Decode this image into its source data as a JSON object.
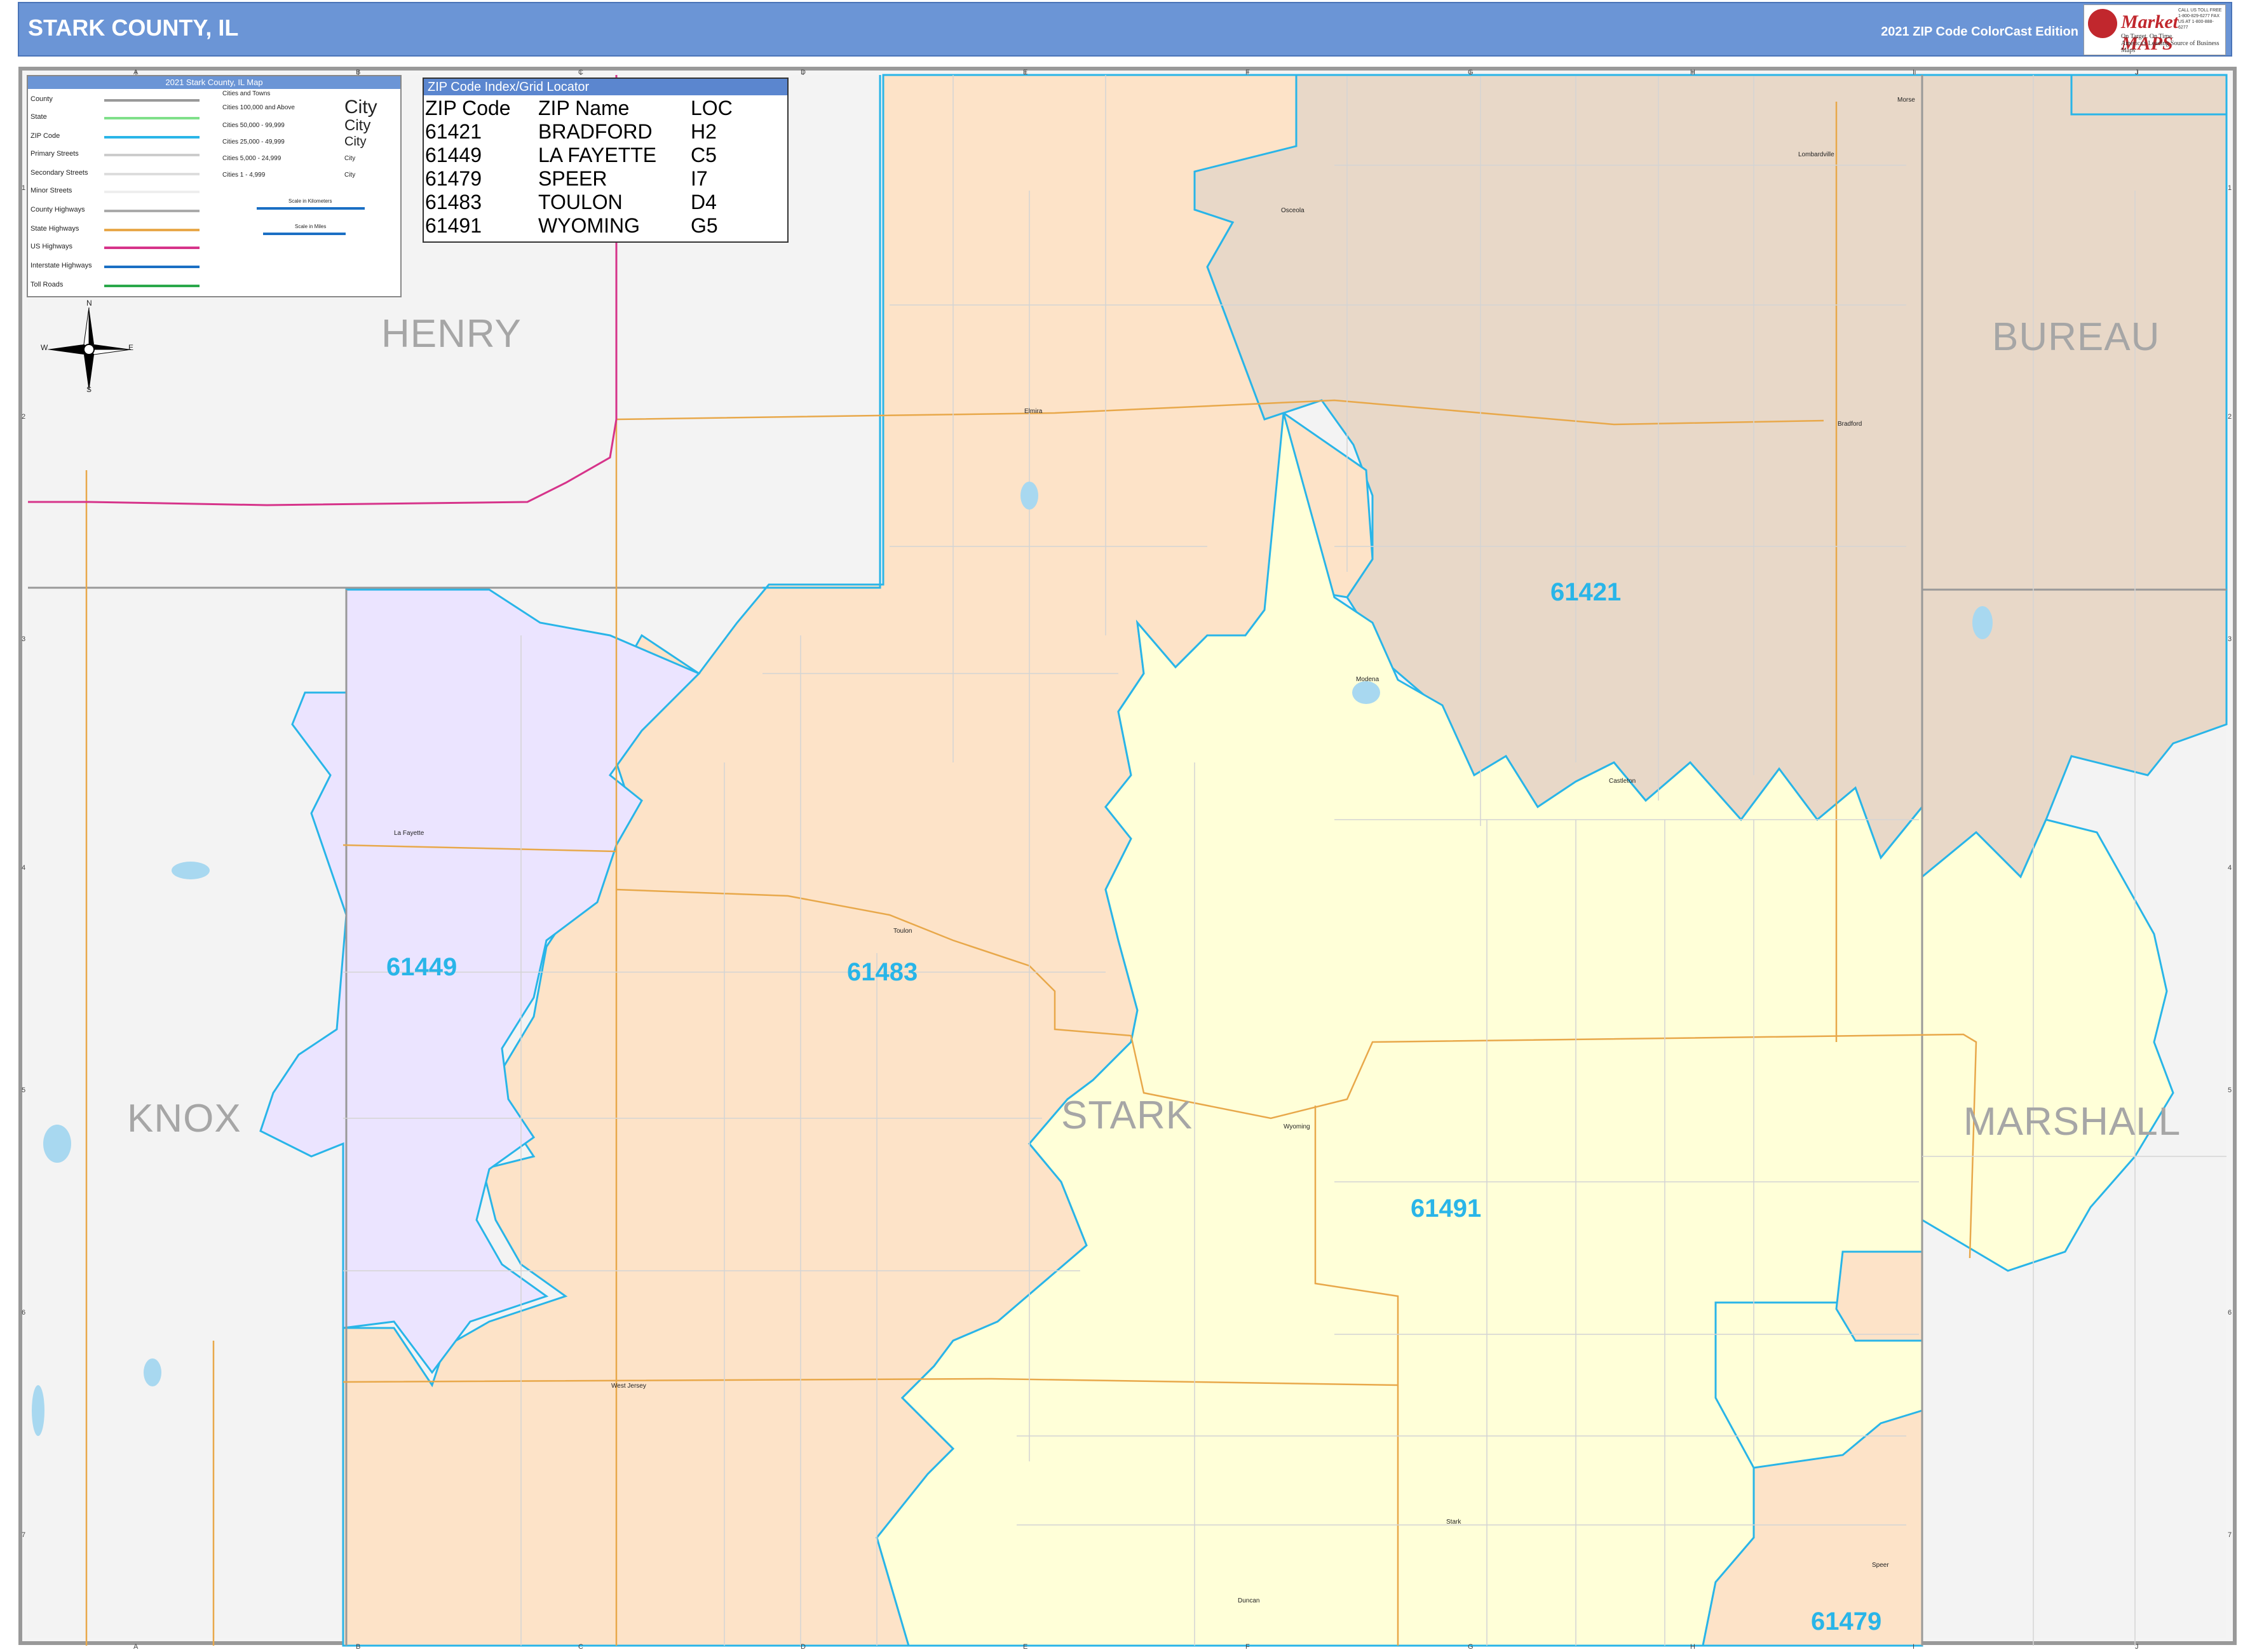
{
  "header": {
    "title": "STARK COUNTY, IL",
    "edition": "2021 ZIP Code ColorCast Edition",
    "logo": {
      "brand": "Market MAPS",
      "tagline": "On Target. On Time.",
      "slogan": "America's Leading Source of Business Maps",
      "contact": "CALL US TOLL FREE 1-800-829-6277 FAX US AT 1-800-888-6277"
    }
  },
  "legend": {
    "title": "2021 Stark County, IL Map",
    "items": [
      "County",
      "State",
      "ZIP Code",
      "Primary Streets",
      "Secondary Streets",
      "Minor Streets",
      "County Highways",
      "State Highways",
      "US Highways",
      "Interstate Highways",
      "Toll Roads"
    ],
    "cities_header": "Cities and Towns",
    "city_sizes": [
      "Cities 100,000 and Above",
      "Cities 50,000 - 99,999",
      "Cities 25,000 - 49,999",
      "Cities 5,000 - 24,999",
      "Cities 1 - 4,999"
    ],
    "city_samples": [
      "City",
      "City",
      "City",
      "City",
      "City"
    ],
    "scale_km": "Scale in Kilometers",
    "scale_mi": "Scale in Miles",
    "colors": {
      "county": "#999999",
      "state": "#7fe08a",
      "zip": "#29b5e8",
      "primary": "#cccccc",
      "secondary": "#dddddd",
      "minor": "#eeeeee",
      "county_hwy": "#aaaaaa",
      "state_hwy": "#e8a84a",
      "us_hwy": "#d6338a",
      "interstate": "#1a6fc4",
      "toll": "#2aa84a"
    }
  },
  "zip_index": {
    "title": "ZIP Code Index/Grid Locator",
    "columns": [
      "ZIP Code",
      "ZIP Name",
      "LOC"
    ],
    "rows": [
      [
        "61421",
        "BRADFORD",
        "H2"
      ],
      [
        "61449",
        "LA FAYETTE",
        "C5"
      ],
      [
        "61479",
        "SPEER",
        "I7"
      ],
      [
        "61483",
        "TOULON",
        "D4"
      ],
      [
        "61491",
        "WYOMING",
        "G5"
      ]
    ]
  },
  "regions": [
    "HENRY",
    "BUREAU",
    "KNOX",
    "STARK",
    "MARSHALL"
  ],
  "zip_areas": [
    {
      "zip": "61421",
      "color": "#e8d8c8"
    },
    {
      "zip": "61449",
      "color": "#ebe4ff"
    },
    {
      "zip": "61483",
      "color": "#fde3c8"
    },
    {
      "zip": "61491",
      "color": "#ffffd8"
    },
    {
      "zip": "61479",
      "color": "#fde3c8"
    }
  ],
  "towns": [
    "Osceola",
    "Elmira",
    "Bradford",
    "Lombardville",
    "Castleton",
    "Modena",
    "La Fayette",
    "Toulon",
    "Wyoming",
    "West Jersey",
    "Stark",
    "Duncan",
    "Speer",
    "Morse"
  ],
  "grid": {
    "letters": [
      "A",
      "B",
      "C",
      "D",
      "E",
      "F",
      "G",
      "H",
      "I",
      "J"
    ],
    "numbers": [
      "1",
      "2",
      "3",
      "4",
      "5",
      "6",
      "7"
    ]
  },
  "compass": {
    "n": "N",
    "s": "S",
    "e": "E",
    "w": "W"
  }
}
